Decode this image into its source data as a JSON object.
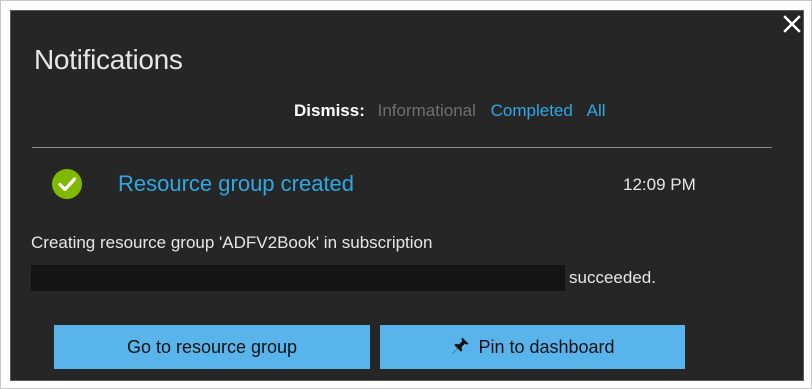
{
  "panel": {
    "title": "Notifications",
    "close_icon": "close-icon"
  },
  "dismiss": {
    "label": "Dismiss:",
    "options": [
      {
        "label": "Informational",
        "state": "disabled"
      },
      {
        "label": "Completed",
        "state": "active"
      },
      {
        "label": "All",
        "state": "active"
      }
    ]
  },
  "notification": {
    "status_icon": "check-circle-icon",
    "status_color": "#7fba00",
    "title": "Resource group created",
    "time": "12:09 PM",
    "message_line1": "Creating resource group 'ADFV2Book' in subscription",
    "message_line2": "succeeded."
  },
  "actions": {
    "go_label": "Go to resource group",
    "pin_label": "Pin to dashboard",
    "pin_icon": "pin-icon"
  },
  "colors": {
    "panel_bg": "#262626",
    "accent": "#2ea8e5",
    "button_bg": "#59b4ec"
  }
}
